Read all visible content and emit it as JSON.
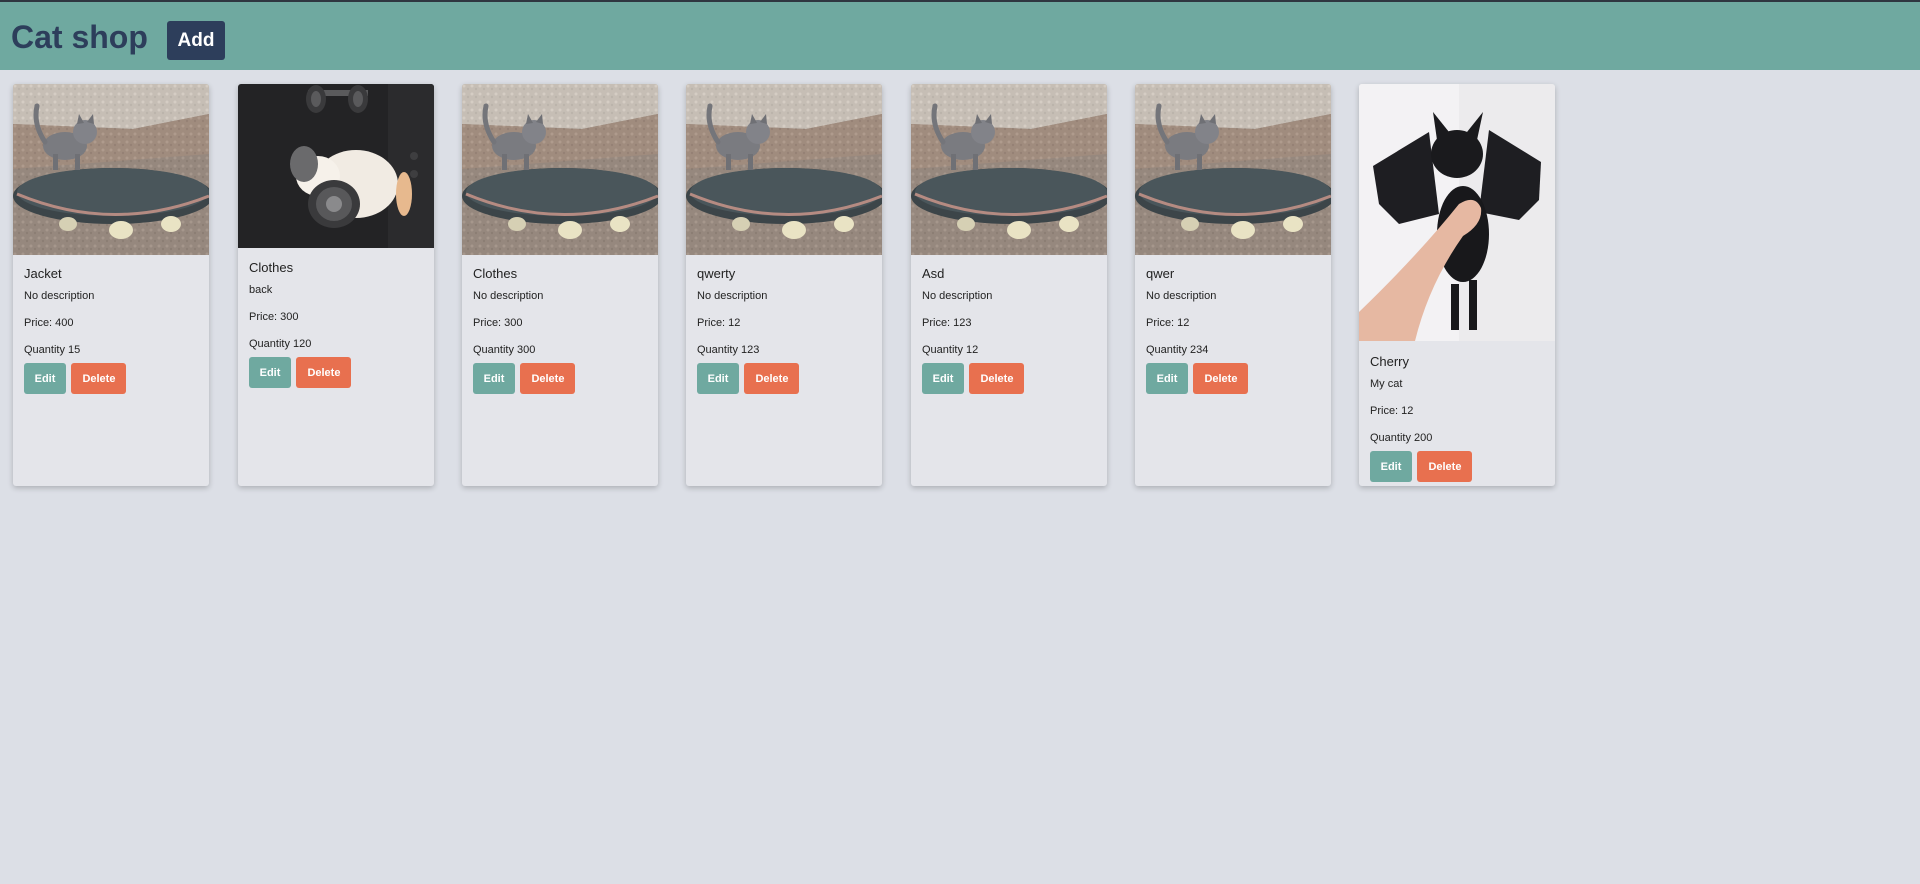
{
  "header": {
    "title": "Cat shop",
    "add_label": "Add",
    "colors": {
      "bar": "#6fa9a0",
      "title": "#2d3e5b",
      "add_button": "#2d3e5b"
    }
  },
  "buttons": {
    "edit_label": "Edit",
    "delete_label": "Delete",
    "colors": {
      "edit": "#6fa9a0",
      "delete": "#e8704f"
    }
  },
  "products": [
    {
      "name": "Jacket",
      "description": "No description",
      "price": "Price: 400",
      "quantity": "Quantity 15",
      "image": "kitten-on-skateboard"
    },
    {
      "name": "Clothes",
      "description": "back",
      "price": "Price: 300",
      "quantity": "Quantity 120",
      "image": "kitten-with-dumbbells"
    },
    {
      "name": "Clothes",
      "description": "No description",
      "price": "Price: 300",
      "quantity": "Quantity 300",
      "image": "kitten-on-skateboard"
    },
    {
      "name": "qwerty",
      "description": "No description",
      "price": "Price: 12",
      "quantity": "Quantity 123",
      "image": "kitten-on-skateboard"
    },
    {
      "name": "Asd",
      "description": "No description",
      "price": "Price: 123",
      "quantity": "Quantity 12",
      "image": "kitten-on-skateboard"
    },
    {
      "name": "qwer",
      "description": "No description",
      "price": "Price: 12",
      "quantity": "Quantity 234",
      "image": "kitten-on-skateboard"
    },
    {
      "name": "Cherry",
      "description": "My cat",
      "price": "Price: 12",
      "quantity": "Quantity 200",
      "image": "black-cat-with-bat-wings"
    }
  ]
}
